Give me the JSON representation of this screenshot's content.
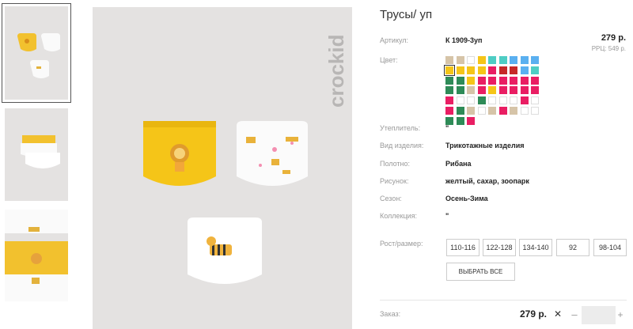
{
  "product": {
    "title": "Трусы/ уп",
    "article_label": "Артикул:",
    "article_value": "К 1909-3уп",
    "price": "279 р.",
    "rrp": "РРЦ: 549 р.",
    "color_label": "Цвет:",
    "brand": "crockid"
  },
  "attributes": [
    {
      "label": "Утеплитель:",
      "value": "\""
    },
    {
      "label": "Вид изделия:",
      "value": "Трикотажные изделия"
    },
    {
      "label": "Полотно:",
      "value": "Рибана"
    },
    {
      "label": "Рисунок:",
      "value": "желтый, сахар, зоопарк"
    },
    {
      "label": "Сезон:",
      "value": "Осень-Зима"
    },
    {
      "label": "Коллекция:",
      "value": "\""
    }
  ],
  "sizes": {
    "label": "Рост/размер:",
    "options": [
      "110-116",
      "122-128",
      "134-140",
      "92",
      "98-104"
    ],
    "select_all": "ВЫБРАТЬ ВСЕ"
  },
  "order": {
    "label": "Заказ:",
    "price": "279 р.",
    "remove": "✕",
    "minus": "–",
    "plus": "+",
    "quantity": ""
  },
  "swatch_colors": [
    [
      "#d6c4a8",
      "#d6c4a8",
      "#ffffff",
      "#f5c518",
      "#4ecdc4",
      "#4ecdc4",
      "#5ab0f0",
      "#5ab0f0",
      "#5ab0f0"
    ],
    [
      "#f5c518",
      "#f5c518",
      "#f5c518",
      "#f5c518",
      "#e91e63",
      "#c62828",
      "#c62828",
      "#5ab0f0",
      "#4ecdc4"
    ],
    [
      "#2e8b57",
      "#2e8b57",
      "#f5c518",
      "#e91e63",
      "#e91e63",
      "#e91e63",
      "#e91e63",
      "#e91e63",
      "#e91e63"
    ],
    [
      "#2e8b57",
      "#2e8b57",
      "#d6c4a8",
      "#e91e63",
      "#f5c518",
      "#e91e63",
      "#e91e63",
      "#e91e63",
      "#e91e63"
    ],
    [
      "#e91e63",
      "#ffffff",
      "#ffffff",
      "#2e8b57",
      "#ffffff",
      "#ffffff",
      "#ffffff",
      "#e91e63",
      "#ffffff"
    ],
    [
      "#e91e63",
      "#2e8b57",
      "#d6c4a8",
      "#ffffff",
      "#d6c4a8",
      "#e91e63",
      "#d6c4a8",
      "#ffffff",
      "#ffffff"
    ],
    [
      "#2e8b57",
      "#2e8b57",
      "#e91e63"
    ]
  ]
}
